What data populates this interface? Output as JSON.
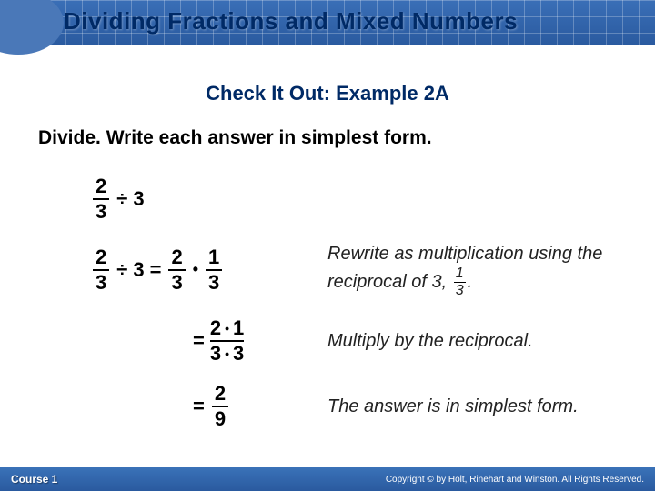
{
  "header": {
    "title": "Dividing Fractions and Mixed Numbers"
  },
  "subtitle": "Check It Out: Example 2A",
  "instruction": "Divide. Write each answer in simplest form.",
  "problem": {
    "lhs_num": "2",
    "lhs_den": "3",
    "op": "÷",
    "rhs": "3"
  },
  "step1": {
    "a_num": "2",
    "a_den": "3",
    "op1": "÷",
    "b": "3",
    "eq": "=",
    "c_num": "2",
    "c_den": "3",
    "dot": "•",
    "d_num": "1",
    "d_den": "3",
    "explain_pre": "Rewrite as multiplication using the reciprocal of 3, ",
    "recip_num": "1",
    "recip_den": "3",
    "explain_post": "."
  },
  "step2": {
    "eq": "=",
    "top_a": "2",
    "top_b": "1",
    "bot_a": "3",
    "bot_b": "3",
    "dot": "•",
    "explain": "Multiply by the reciprocal."
  },
  "step3": {
    "eq": "=",
    "num": "2",
    "den": "9",
    "explain": "The answer is in simplest form."
  },
  "footer": {
    "course": "Course 1",
    "copyright": "Copyright © by Holt, Rinehart and Winston. All Rights Reserved."
  }
}
